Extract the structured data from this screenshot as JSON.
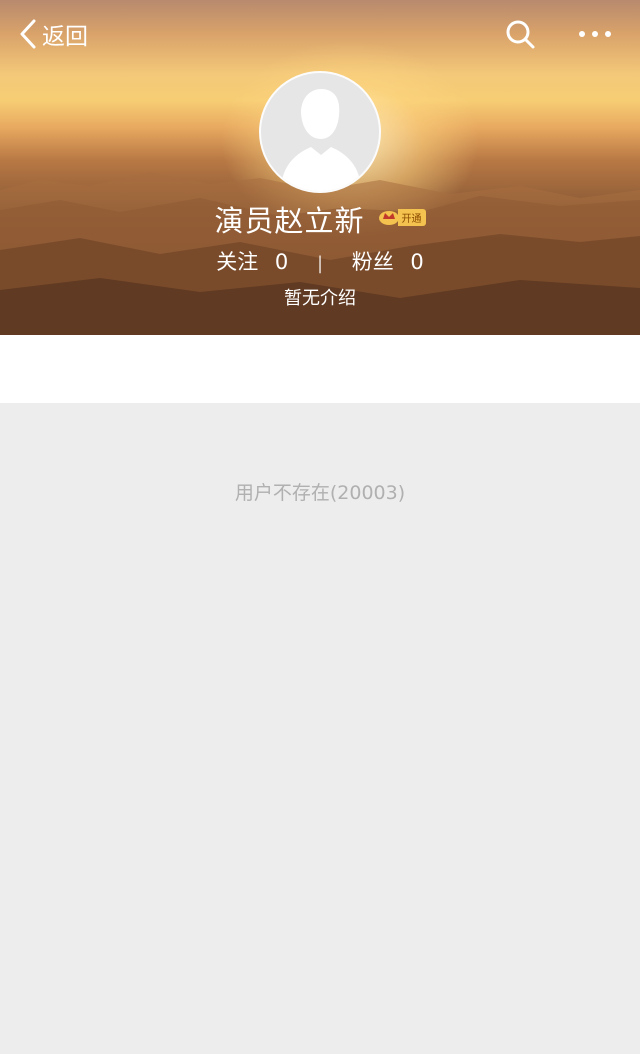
{
  "nav": {
    "back_label": "返回"
  },
  "profile": {
    "name": "演员赵立新",
    "vip_badge": "开通",
    "following_label": "关注",
    "following_count": "0",
    "separator": "|",
    "followers_label": "粉丝",
    "followers_count": "0",
    "intro": "暂无介绍"
  },
  "content": {
    "error_message": "用户不存在(20003)"
  },
  "colors": {
    "page_background": "#ededed",
    "error_text": "#b0b0b0",
    "vip_gold": "#f4c24e"
  },
  "icons": [
    "back-chevron-icon",
    "search-icon",
    "more-icon",
    "default-avatar-icon",
    "vip-crown-icon"
  ]
}
